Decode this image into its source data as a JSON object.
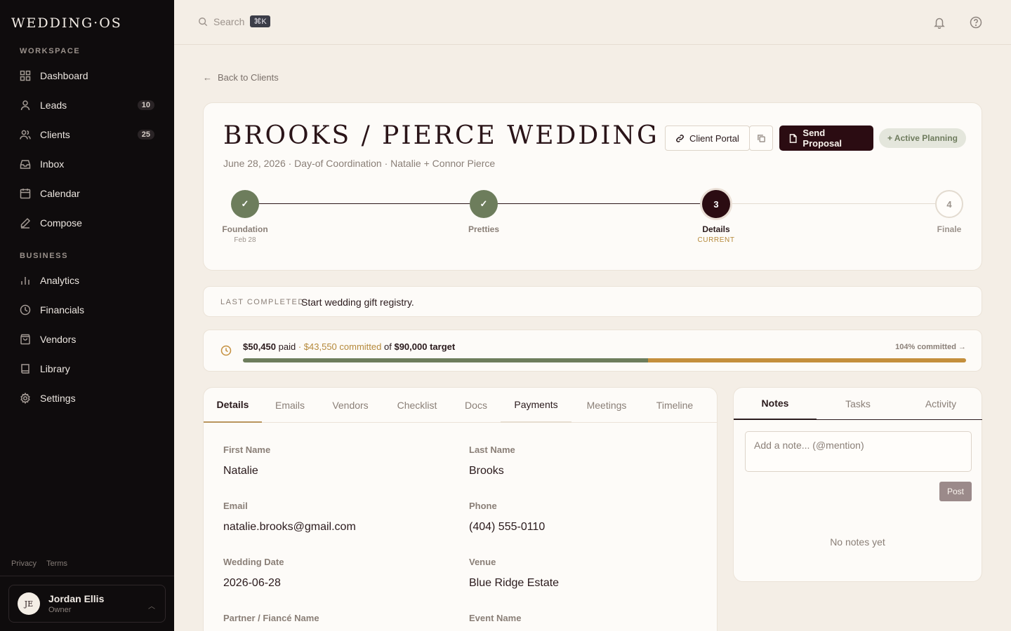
{
  "app": {
    "logo": "WEDDING·OS"
  },
  "sidebar": {
    "workspace_label": "WORKSPACE",
    "business_label": "BUSINESS",
    "workspace_items": [
      {
        "label": "Dashboard",
        "icon": "grid-icon"
      },
      {
        "label": "Leads",
        "icon": "user-icon",
        "badge": "10"
      },
      {
        "label": "Clients",
        "icon": "users-icon",
        "badge": "25"
      },
      {
        "label": "Inbox",
        "icon": "inbox-icon"
      },
      {
        "label": "Calendar",
        "icon": "calendar-icon"
      },
      {
        "label": "Compose",
        "icon": "pencil-icon"
      }
    ],
    "business_items": [
      {
        "label": "Analytics",
        "icon": "bar-chart-icon"
      },
      {
        "label": "Financials",
        "icon": "clock-icon"
      },
      {
        "label": "Vendors",
        "icon": "shopping-bag-icon"
      },
      {
        "label": "Library",
        "icon": "book-icon"
      },
      {
        "label": "Settings",
        "icon": "gear-icon"
      }
    ],
    "footer": {
      "privacy": "Privacy",
      "terms": "Terms"
    },
    "user": {
      "initials": "JE",
      "name": "Jordan Ellis",
      "role": "Owner"
    }
  },
  "topbar": {
    "search_placeholder": "Search",
    "shortcut": "⌘K"
  },
  "back_link": "Back to Clients",
  "client": {
    "title": "BROOKS / PIERCE WEDDING",
    "subtitle": "June 28, 2026 · Day-of Coordination · Natalie + Connor Pierce",
    "client_portal": "Client Portal",
    "send_proposal": "Send Proposal",
    "status": "+ Active Planning"
  },
  "steps": [
    {
      "label": "Foundation",
      "sub": "Feb 28",
      "state": "done",
      "marker": "✓"
    },
    {
      "label": "Pretties",
      "sub": "",
      "state": "done",
      "marker": "✓"
    },
    {
      "label": "Details",
      "sub": "CURRENT",
      "state": "current",
      "marker": "3"
    },
    {
      "label": "Finale",
      "sub": "",
      "state": "pending",
      "marker": "4"
    }
  ],
  "last_completed": {
    "label": "LAST COMPLETED",
    "text": "Start wedding gift registry."
  },
  "budget": {
    "paid": "$50,450",
    "paid_word": "paid",
    "sep": "·",
    "committed": "$43,550 committed",
    "of": "of",
    "target": "$90,000 target",
    "right": "104% committed →",
    "paid_fraction": 0.5606,
    "committed_fraction": 0.4394,
    "colors": {
      "paid": "#6d7d5c",
      "committed": "#c48f3d"
    }
  },
  "tabs": [
    "Details",
    "Emails",
    "Vendors",
    "Checklist",
    "Docs",
    "Payments",
    "Meetings",
    "Timeline"
  ],
  "fields": [
    {
      "label": "First Name",
      "value": "Natalie"
    },
    {
      "label": "Last Name",
      "value": "Brooks"
    },
    {
      "label": "Email",
      "value": "natalie.brooks@gmail.com"
    },
    {
      "label": "Phone",
      "value": "(404) 555-0110"
    },
    {
      "label": "Wedding Date",
      "value": "2026-06-28"
    },
    {
      "label": "Venue",
      "value": "Blue Ridge Estate"
    },
    {
      "label": "Partner / Fiancé Name",
      "value": ""
    },
    {
      "label": "Event Name",
      "value": ""
    }
  ],
  "notes": {
    "tabs": [
      "Notes",
      "Tasks",
      "Activity"
    ],
    "placeholder": "Add a note... (@mention)",
    "post": "Post",
    "empty": "No notes yet"
  }
}
